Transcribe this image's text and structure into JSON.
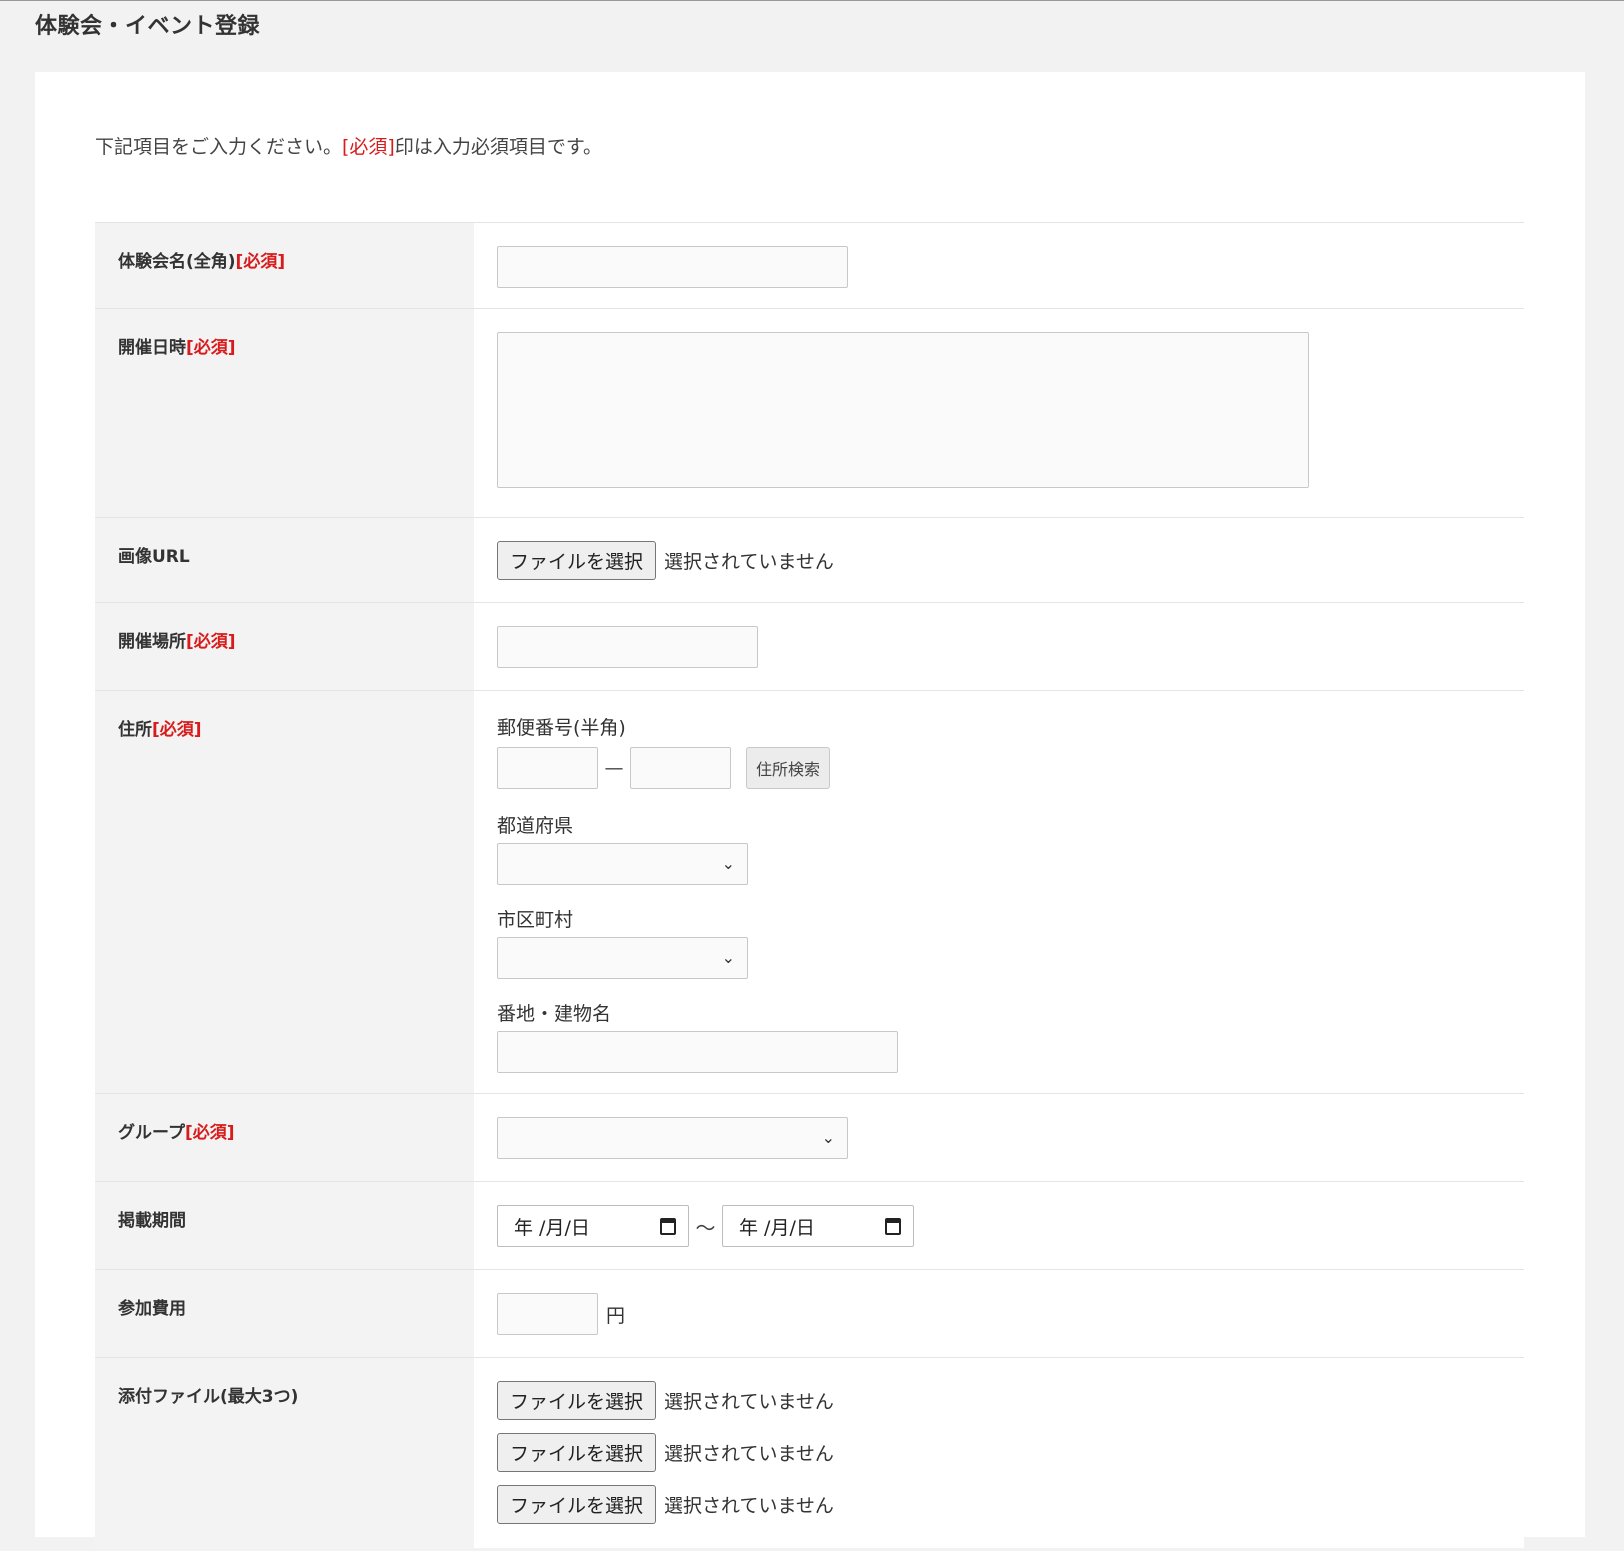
{
  "page": {
    "title": "体験会・イベント登録"
  },
  "intro": {
    "before": "下記項目をご入力ください。",
    "required_mark": "[必須]",
    "after": "印は入力必須項目です。"
  },
  "required_tag": "[必須]",
  "form": {
    "event_name": {
      "label": "体験会名(全角)",
      "value": ""
    },
    "datetime": {
      "label": "開催日時",
      "value": ""
    },
    "image_url": {
      "label": "画像URL",
      "button": "ファイルを選択",
      "status": "選択されていません"
    },
    "venue": {
      "label": "開催場所",
      "value": ""
    },
    "address": {
      "label": "住所",
      "zip_label": "郵便番号(半角)",
      "zip_dash": "—",
      "search_button": "住所検索",
      "prefecture_label": "都道府県",
      "city_label": "市区町村",
      "street_label": "番地・建物名"
    },
    "group": {
      "label": "グループ",
      "value": ""
    },
    "period": {
      "label": "掲載期間",
      "start_placeholder": "年 /月/日",
      "separator": "～",
      "end_placeholder": "年 /月/日"
    },
    "fee": {
      "label": "参加費用",
      "unit": "円"
    },
    "attachments": {
      "label": "添付ファイル(最大3つ)",
      "items": [
        {
          "button": "ファイルを選択",
          "status": "選択されていません"
        },
        {
          "button": "ファイルを選択",
          "status": "選択されていません"
        },
        {
          "button": "ファイルを選択",
          "status": "選択されていません"
        }
      ]
    }
  },
  "icons": {
    "select_arrow": "chevron-down-icon",
    "date_picker": "calendar-icon"
  },
  "colors": {
    "required": "#d81b1b",
    "label_bg": "#f3f3f3",
    "page_bg": "#f2f2f2"
  }
}
